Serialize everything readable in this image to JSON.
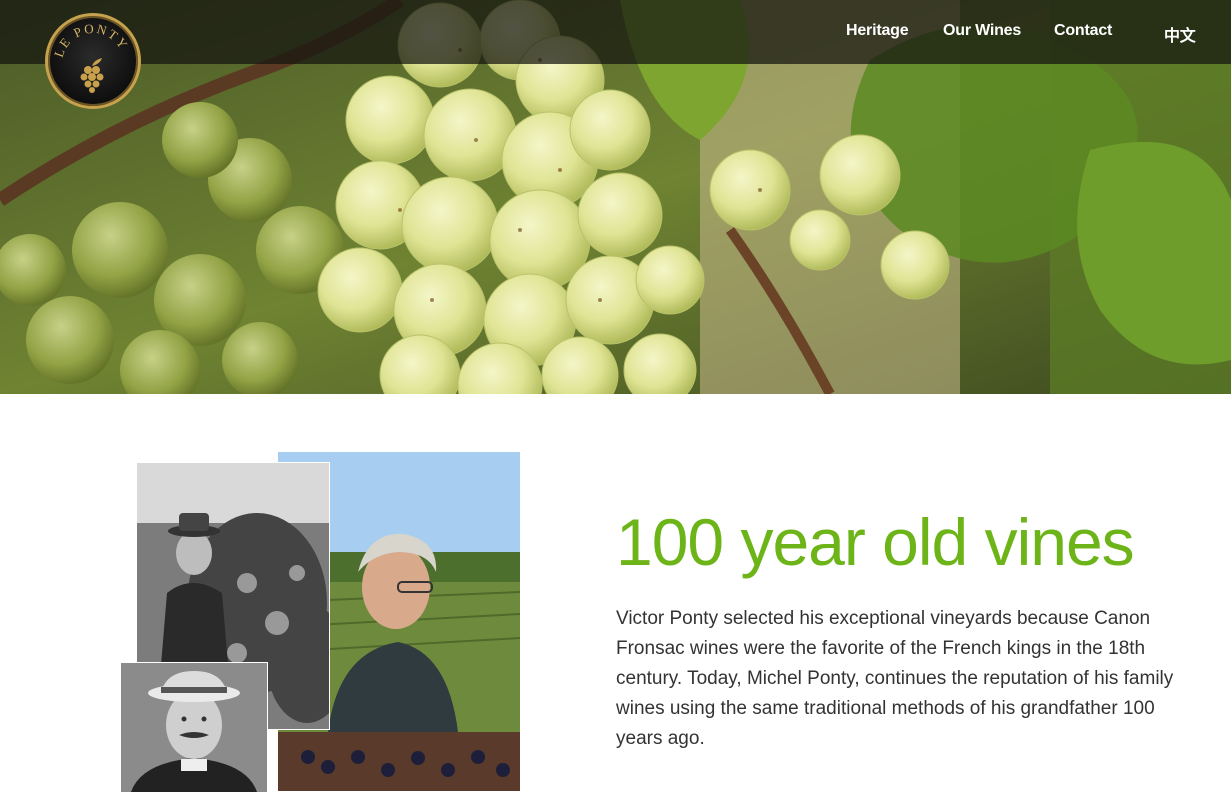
{
  "nav": {
    "logo_text": "LE PONTY",
    "items": [
      {
        "label": "Heritage"
      },
      {
        "label": "Our Wines"
      },
      {
        "label": "Contact"
      },
      {
        "label": "中文"
      }
    ]
  },
  "hero": {
    "image": "grape-cluster-photo"
  },
  "intro": {
    "headline": "100 year old vines",
    "body": "Victor Ponty selected his exceptional vineyards because Canon Fronsac wines were the favorite of the French kings in the 18th century. Today, Michel Ponty, continues the reputation of his family wines using the same traditional methods of his grandfather 100 years ago.",
    "images": [
      "vintage-vineyard-photo",
      "modern-winemaker-photo",
      "vintage-portrait-photo"
    ]
  },
  "colors": {
    "accent_green": "#6db418",
    "logo_gold": "#c7a24e",
    "text": "#333333"
  }
}
